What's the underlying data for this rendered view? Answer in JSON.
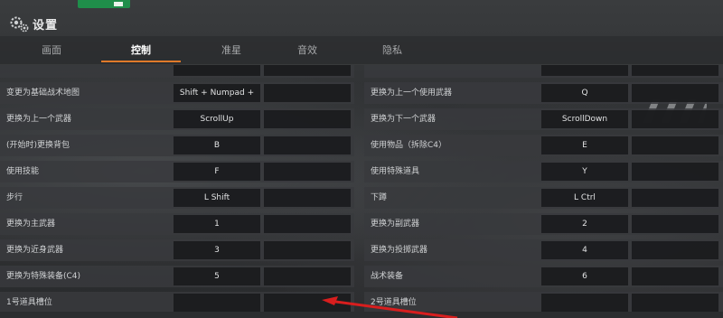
{
  "window": {
    "title": "设置"
  },
  "tabs": [
    {
      "label": "画面",
      "active": false
    },
    {
      "label": "控制",
      "active": true
    },
    {
      "label": "准星",
      "active": false
    },
    {
      "label": "音效",
      "active": false
    },
    {
      "label": "隐私",
      "active": false
    }
  ],
  "bindings": {
    "left": [
      {
        "label": "",
        "key": ""
      },
      {
        "label": "变更为基础战术地图",
        "key": "Shift + Numpad +"
      },
      {
        "label": "更换为上一个武器",
        "key": "ScrollUp"
      },
      {
        "label": "(开始时)更换背包",
        "key": "B"
      },
      {
        "label": "使用技能",
        "key": "F"
      },
      {
        "label": "步行",
        "key": "L Shift"
      },
      {
        "label": "更换为主武器",
        "key": "1"
      },
      {
        "label": "更换为近身武器",
        "key": "3"
      },
      {
        "label": "更换为特殊装备(C4)",
        "key": "5"
      },
      {
        "label": "1号道具槽位",
        "key": ""
      }
    ],
    "right": [
      {
        "label": "",
        "key": ""
      },
      {
        "label": "更换为上一个使用武器",
        "key": "Q"
      },
      {
        "label": "更换为下一个武器",
        "key": "ScrollDown"
      },
      {
        "label": "使用物品（拆除C4）",
        "key": "E"
      },
      {
        "label": "使用特殊道具",
        "key": "Y"
      },
      {
        "label": "下蹲",
        "key": "L Ctrl"
      },
      {
        "label": "更换为副武器",
        "key": "2"
      },
      {
        "label": "更换为投掷武器",
        "key": "4"
      },
      {
        "label": "战术装备",
        "key": "6"
      },
      {
        "label": "2号道具槽位",
        "key": ""
      }
    ]
  },
  "colors": {
    "accent": "#e07a2a",
    "arrow": "#d81e1e",
    "sign": "#1f8e4a"
  },
  "icons": {
    "settings": "gear-icon",
    "annotation": "red-arrow-icon"
  }
}
